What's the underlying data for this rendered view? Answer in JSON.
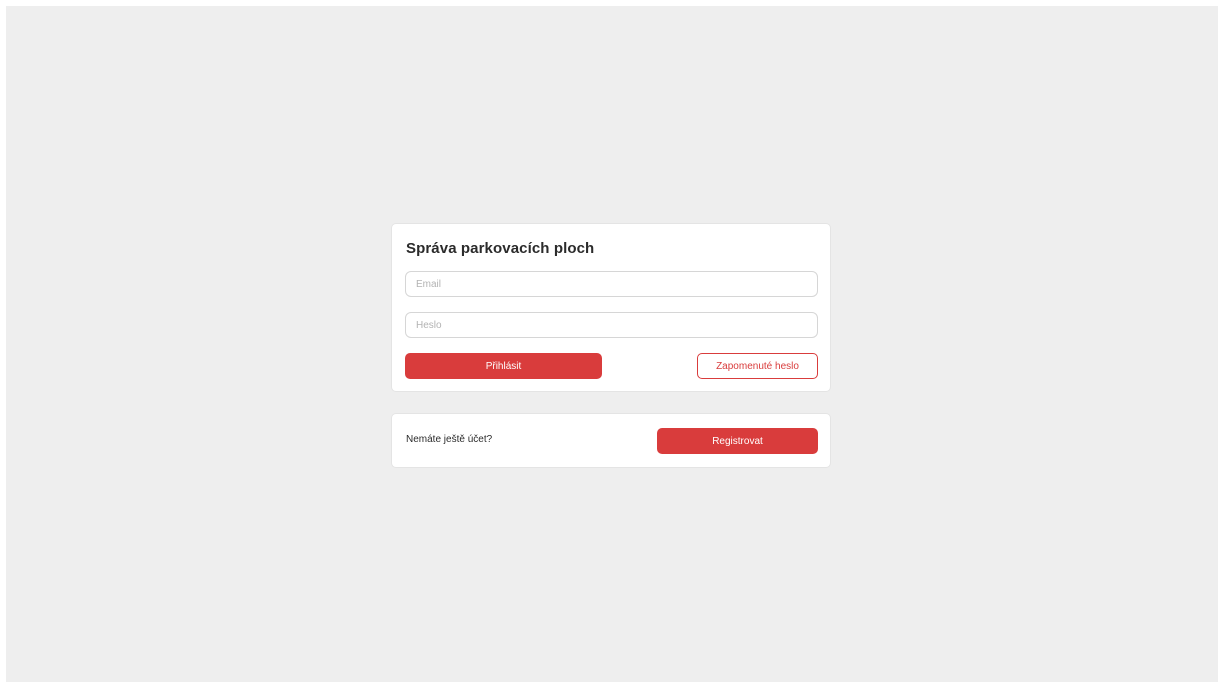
{
  "login": {
    "title": "Správa parkovacích ploch",
    "email_placeholder": "Email",
    "password_placeholder": "Heslo",
    "login_label": "Přihlásit",
    "forgot_label": "Zapomenuté heslo"
  },
  "register": {
    "prompt": "Nemáte ještě účet?",
    "register_label": "Registrovat"
  },
  "colors": {
    "accent": "#d93c3c",
    "background": "#eeeeee",
    "card": "#ffffff"
  }
}
